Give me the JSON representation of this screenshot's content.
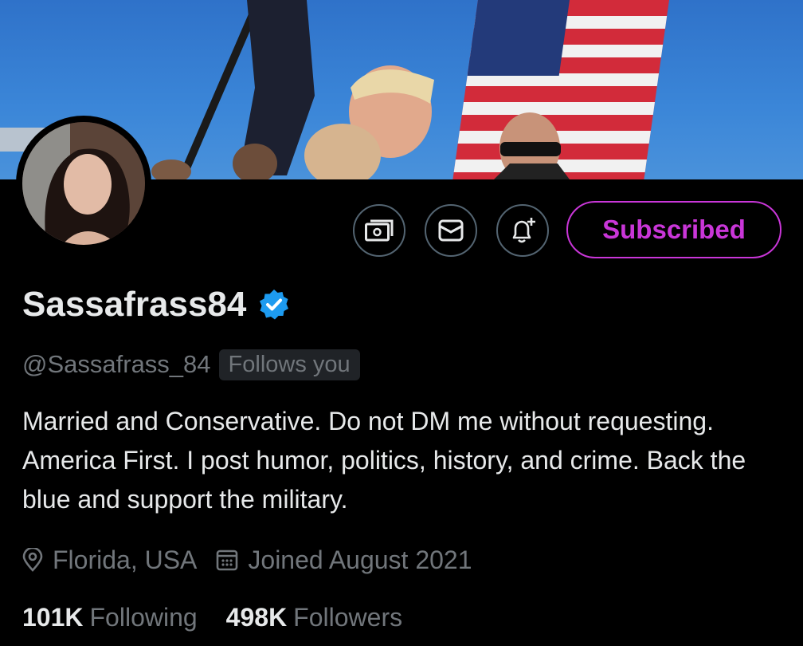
{
  "profile": {
    "display_name": "Sassafrass84",
    "handle": "@Sassafrass_84",
    "follows_you": "Follows you",
    "bio": "Married and Conservative. Do not DM me without requesting. America First. I post humor, politics, history, and crime. Back the blue and support the military.",
    "location": "Florida, USA",
    "joined": "Joined August 2021",
    "following_count": "101K",
    "following_label": "Following",
    "followers_count": "498K",
    "followers_label": "Followers"
  },
  "actions": {
    "subscribe_label": "Subscribed"
  },
  "icons": {
    "tip": "money-icon",
    "message": "envelope-icon",
    "notify": "bell-plus-icon",
    "verified": "verified-badge-icon",
    "location": "location-pin-icon",
    "calendar": "calendar-icon"
  },
  "colors": {
    "background": "#000000",
    "text_primary": "#e7e9ea",
    "text_secondary": "#71767b",
    "subscribe_accent": "#c936d8",
    "verified_blue": "#1d9bf0"
  }
}
